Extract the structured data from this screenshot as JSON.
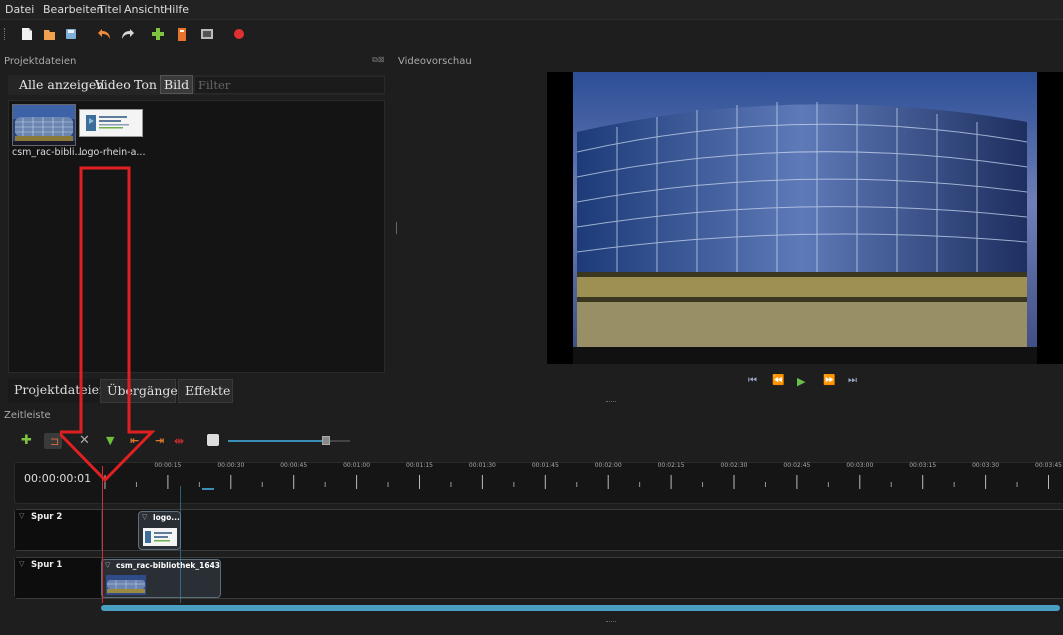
{
  "menu": [
    "Datei",
    "Bearbeiten",
    "Titel",
    "Ansicht",
    "Hilfe"
  ],
  "toolbar": {
    "icons": [
      "new-project-icon",
      "open-project-icon",
      "save-project-icon",
      "undo-icon",
      "redo-icon",
      "import-files-icon",
      "profile-icon",
      "fullscreen-icon",
      "record-icon"
    ]
  },
  "project_files": {
    "title": "Projektdateien",
    "tabs": [
      "Alle anzeigen",
      "Video",
      "Ton",
      "Bild"
    ],
    "active_tab": "Bild",
    "filter_placeholder": "Filter",
    "files": [
      {
        "label": "csm_rac-bibli..."
      },
      {
        "label": "logo-rhein-a..."
      }
    ]
  },
  "preview": {
    "title": "Videovorschau",
    "controls": [
      "jump-start-icon",
      "rewind-icon",
      "play-icon",
      "fast-forward-icon",
      "jump-end-icon"
    ]
  },
  "bottom_tabs": [
    "Projektdateien",
    "Übergänge",
    "Effekte"
  ],
  "timeline": {
    "title": "Zeitleiste",
    "timecode": "00:00:00:01",
    "tick_labels": [
      "00:00:15",
      "00:00:30",
      "00:00:45",
      "00:01:00",
      "00:01:15",
      "00:01:30",
      "00:01:45",
      "00:02:00",
      "00:02:15",
      "00:02:30",
      "00:02:45",
      "00:03:00",
      "00:03:15",
      "00:03:30",
      "00:03:45"
    ],
    "zoom_level": 0.8,
    "tracks": [
      {
        "name": "Spur 2",
        "clip": "logo..."
      },
      {
        "name": "Spur 1",
        "clip": "csm_rac-bibliothek_1643..."
      }
    ]
  },
  "colors": {
    "accent": "#3a8fb7",
    "arrow": "#e02020",
    "playhead": "#d03030"
  }
}
